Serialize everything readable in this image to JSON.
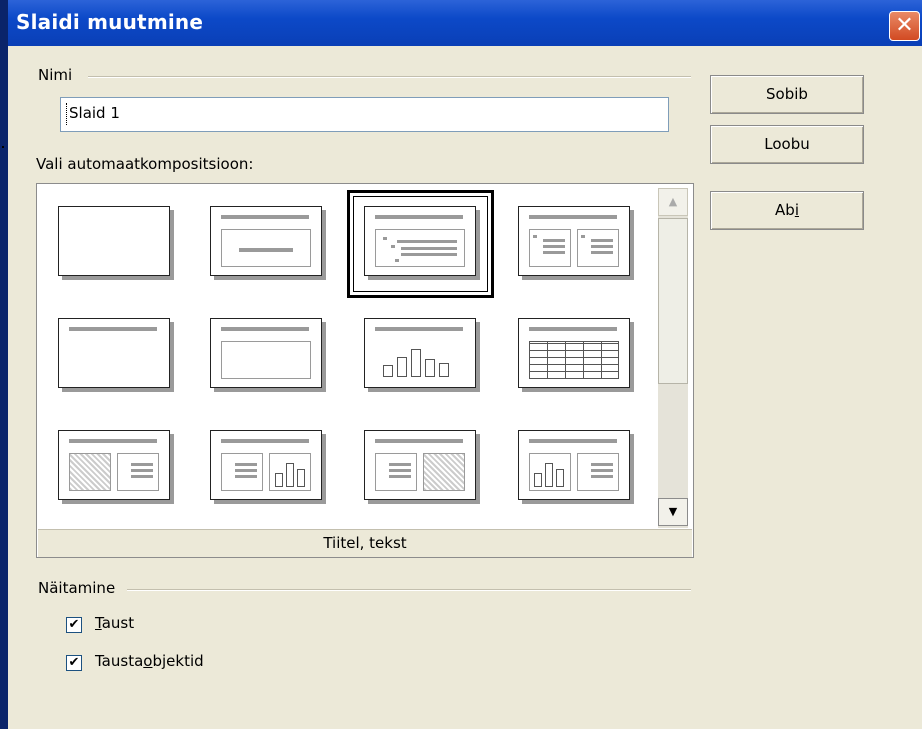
{
  "window": {
    "title": "Slaidi muutmine",
    "close_icon": "close-icon"
  },
  "name_group": {
    "label": "Nimi",
    "input_value": "Slaid 1"
  },
  "layout_group": {
    "label": "Vali automaatkompositsioon:",
    "caption": "Tiitel, tekst",
    "selected_index": 2
  },
  "buttons": {
    "ok": "Sobib",
    "cancel": "Loobu",
    "help_prefix": "Ab",
    "help_mnemonic": "i"
  },
  "display_group": {
    "label": "Näitamine",
    "background_checked": true,
    "background_mnemonic": "T",
    "background_rest": "aust",
    "objects_checked": true,
    "objects_pre": "Tausta",
    "objects_mnemonic": "o",
    "objects_post": "bjektid"
  },
  "check_mark": "✔"
}
